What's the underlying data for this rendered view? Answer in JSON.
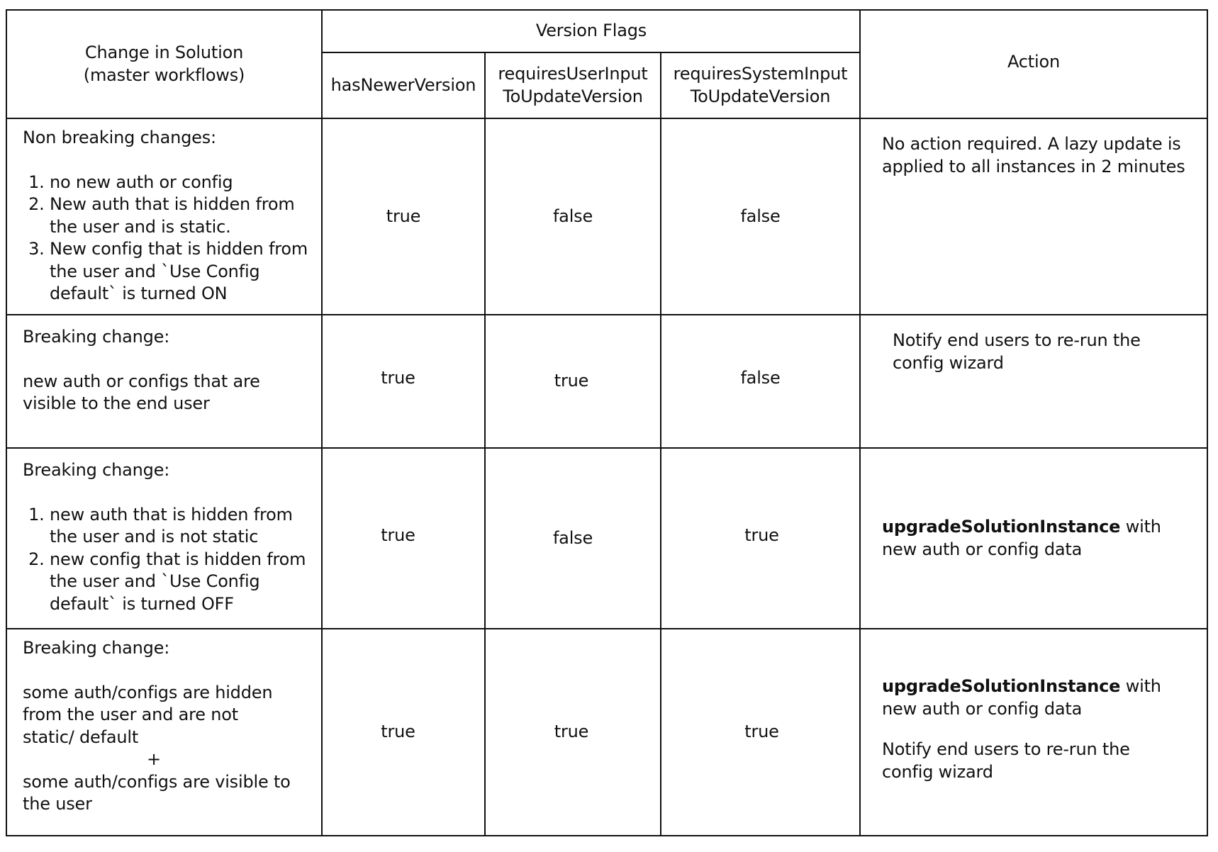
{
  "table": {
    "headers": {
      "change": "Change in Solution\n(master workflows)",
      "change_line1": "Change in Solution",
      "change_line2": "(master workflows)",
      "version_flags": "Version Flags",
      "flags": [
        {
          "line1": "hasNewerVersion",
          "line2": ""
        },
        {
          "line1": "requiresUserInput",
          "line2": "ToUpdateVersion"
        },
        {
          "line1": "requiresSystemInput",
          "line2": "ToUpdateVersion"
        }
      ],
      "action": "Action"
    },
    "rows": [
      {
        "change_title": "Non breaking changes:",
        "change_items": [
          "no new auth or config",
          "New auth that is hidden from the user and is static.",
          "New config that is hidden from the user and `Use Config default` is turned ON"
        ],
        "hasNewerVersion": "true",
        "requiresUserInputToUpdateVersion": "false",
        "requiresSystemInputToUpdateVersion": "false",
        "action": {
          "bold": "",
          "text": "No action required. A lazy update is applied to all instances in 2 minutes",
          "extra": ""
        }
      },
      {
        "change_title": "Breaking change:",
        "change_text": "new auth or configs that are visible to the end user",
        "hasNewerVersion": "true",
        "requiresUserInputToUpdateVersion": "true",
        "requiresSystemInputToUpdateVersion": "false",
        "action": {
          "bold": "",
          "text": "Notify end users to re-run the config wizard",
          "extra": ""
        }
      },
      {
        "change_title": "Breaking change:",
        "change_items": [
          "new auth that is hidden from the user and is not static",
          "new config that is hidden from the user and `Use Config default` is turned OFF"
        ],
        "hasNewerVersion": "true",
        "requiresUserInputToUpdateVersion": "false",
        "requiresSystemInputToUpdateVersion": "true",
        "action": {
          "bold": "upgradeSolutionInstance",
          "text": " with new auth or config data",
          "extra": ""
        }
      },
      {
        "change_title": "Breaking change:",
        "change_text": "some auth/configs are hidden from the user and are not static/ default",
        "change_joiner": "+",
        "change_text2": "some auth/configs are visible to the user",
        "hasNewerVersion": "true",
        "requiresUserInputToUpdateVersion": "true",
        "requiresSystemInputToUpdateVersion": "true",
        "action": {
          "bold": "upgradeSolutionInstance",
          "text": " with new auth or config data",
          "extra": "Notify end users to re-run the config wizard"
        }
      }
    ]
  }
}
